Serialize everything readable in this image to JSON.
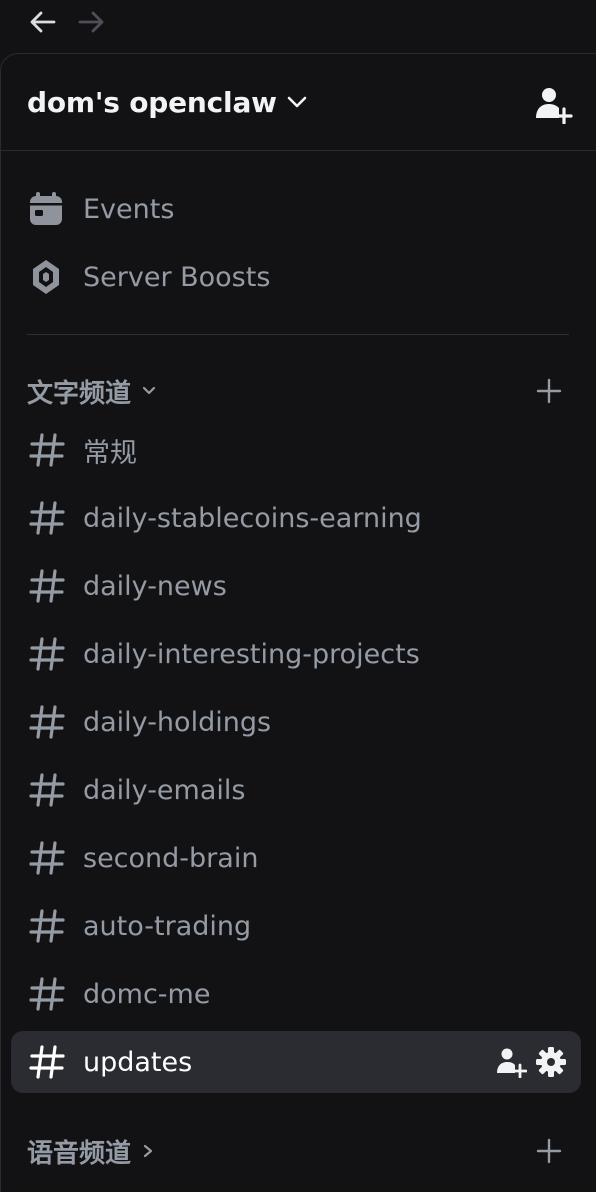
{
  "nav": {
    "back_icon": "arrow-left-icon",
    "forward_icon": "arrow-right-icon"
  },
  "server": {
    "name": "dom's openclaw",
    "dropdown_icon": "chevron-down-icon",
    "invite_icon": "add-member-icon"
  },
  "menu": [
    {
      "label": "Events",
      "icon": "calendar-icon"
    },
    {
      "label": "Server Boosts",
      "icon": "boost-gem-icon"
    }
  ],
  "text_category": {
    "label": "文字频道",
    "icon": "chevron-down-icon",
    "add_icon": "plus-icon"
  },
  "channels": [
    {
      "name": "常规"
    },
    {
      "name": "daily-stablecoins-earning"
    },
    {
      "name": "daily-news"
    },
    {
      "name": "daily-interesting-projects"
    },
    {
      "name": "daily-holdings"
    },
    {
      "name": "daily-emails"
    },
    {
      "name": "second-brain"
    },
    {
      "name": "auto-trading"
    },
    {
      "name": "domc-me"
    },
    {
      "name": "updates",
      "active": true,
      "action_icons": [
        "create-invite-icon",
        "settings-gear-icon"
      ]
    }
  ],
  "voice_category": {
    "label": "语音频道",
    "icon": "chevron-right-icon",
    "add_icon": "plus-icon"
  },
  "colors": {
    "background": "#121214",
    "active_row": "#2b2c31",
    "muted_text": "#949ba4",
    "bright_text": "#f2f3f5"
  }
}
